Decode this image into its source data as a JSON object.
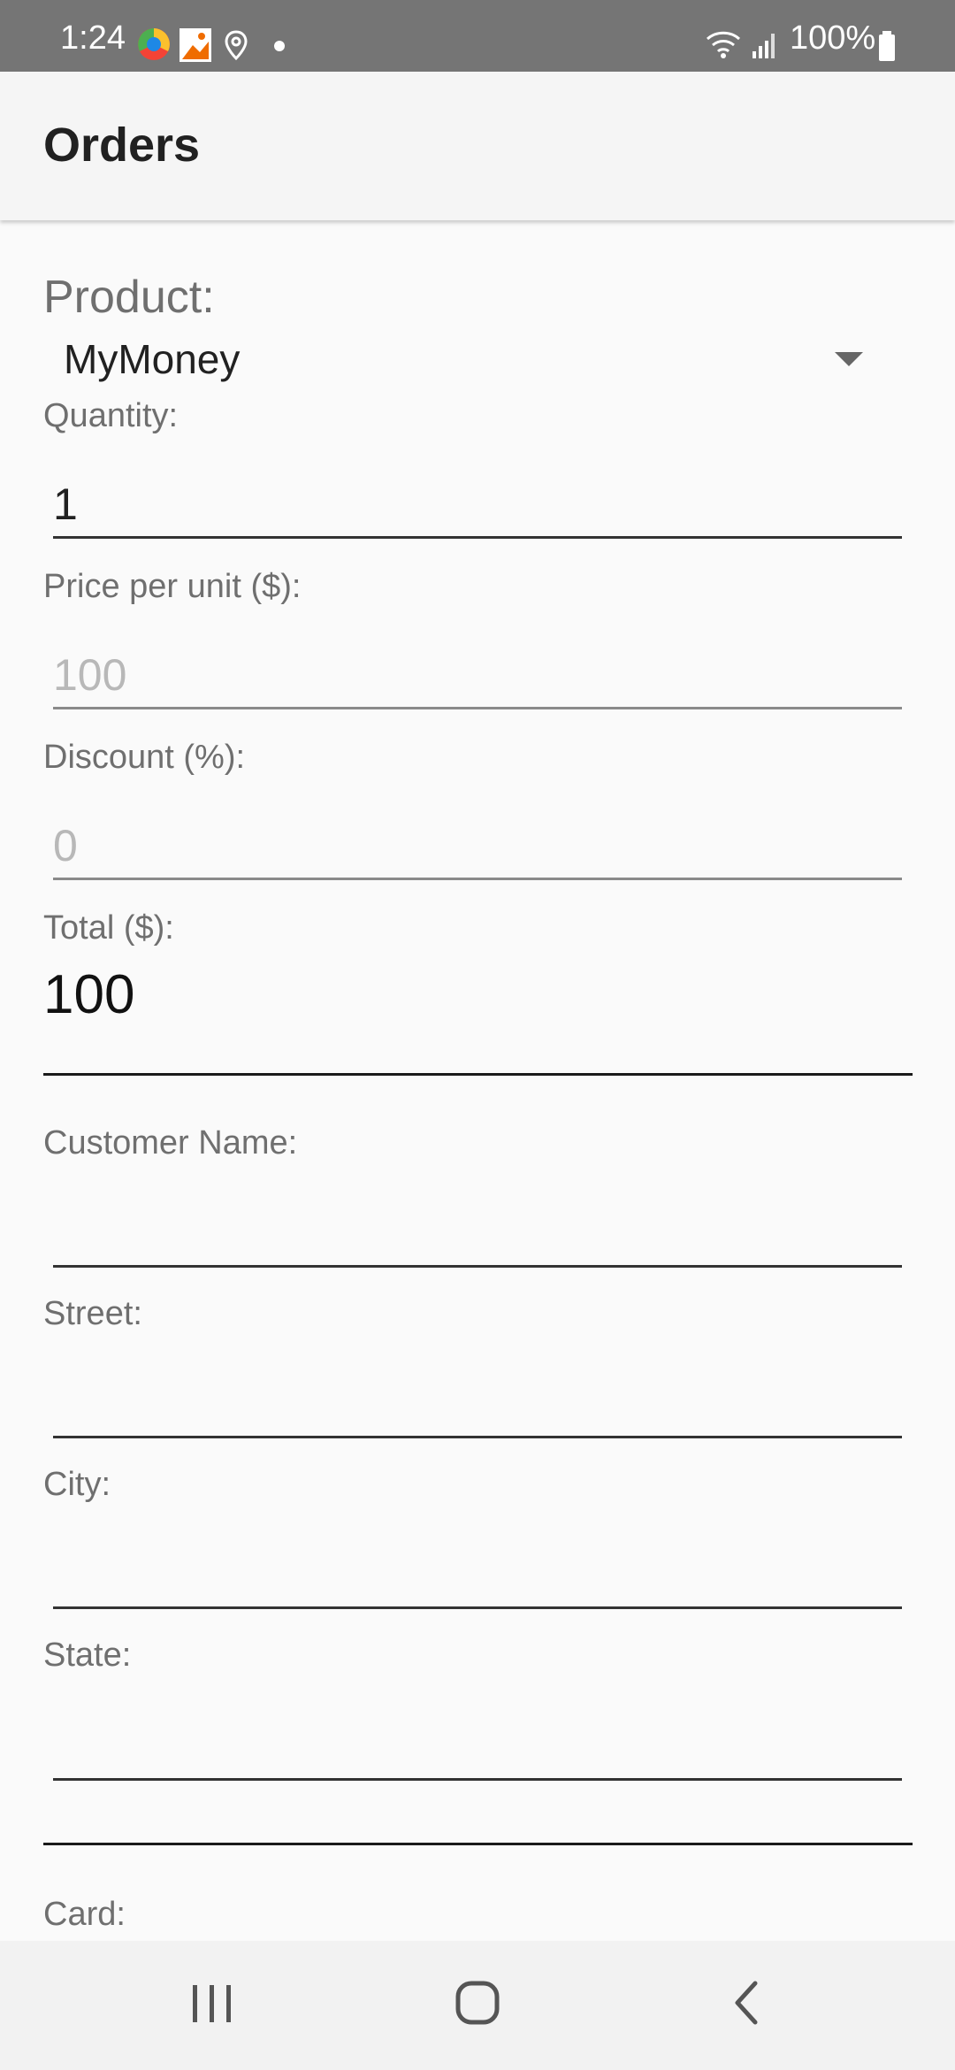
{
  "status_bar": {
    "time": "1:24",
    "battery": "100%",
    "icons": [
      "chrome-like-icon",
      "photo-icon",
      "location-icon",
      "dot-icon",
      "wifi-icon",
      "signal-icon",
      "battery-icon"
    ]
  },
  "app_bar": {
    "title": "Orders"
  },
  "form": {
    "product_label": "Product:",
    "product_value": "MyMoney",
    "quantity_label": "Quantity:",
    "quantity_value": "1",
    "price_label": "Price per unit ($):",
    "price_value": "100",
    "discount_label": "Discount (%):",
    "discount_value": "0",
    "total_label": "Total ($):",
    "total_value": "100",
    "customer_name_label": "Customer Name:",
    "street_label": "Street:",
    "city_label": "City:",
    "state_label": "State:",
    "card_label": "Card:"
  },
  "nav_bar": {
    "buttons": [
      "recent-apps-icon",
      "home-icon",
      "back-icon"
    ]
  },
  "colors": {
    "status_bar": "#757575",
    "app_bar": "#f5f5f5",
    "background": "#fafafa",
    "label": "#6f6f6f",
    "muted_value": "#b8b8b8"
  }
}
